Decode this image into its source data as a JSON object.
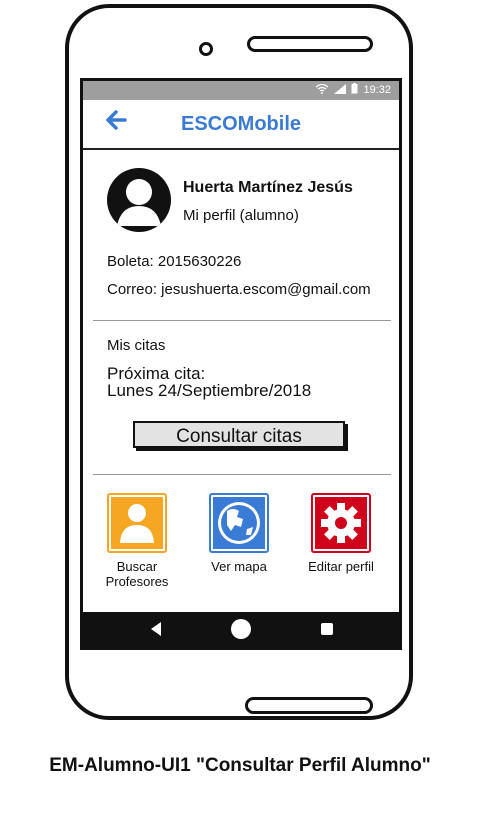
{
  "status": {
    "time": "19:32"
  },
  "appbar": {
    "title": "ESCOMobile",
    "back_icon": "arrow-left-icon"
  },
  "profile": {
    "name": "Huerta Martínez Jesús",
    "role": "Mi perfil (alumno)",
    "boleta": "Boleta:  2015630226",
    "correo": "Correo: jesushuerta.escom@gmail.com"
  },
  "citas": {
    "heading": "Mis citas",
    "proxima_label": "Próxima cita:",
    "proxima_value": "Lunes 24/Septiembre/2018",
    "button": "Consultar citas"
  },
  "actions": [
    {
      "label_line1": "Buscar",
      "label_line2": "Profesores",
      "icon": "person-icon",
      "color": "#f5a623"
    },
    {
      "label_line1": "Ver mapa",
      "label_line2": "",
      "icon": "globe-icon",
      "color": "#3a7bd5"
    },
    {
      "label_line1": "Editar perfil",
      "label_line2": "",
      "icon": "gear-icon",
      "color": "#d0021b"
    }
  ],
  "caption": "EM-Alumno-UI1 \"Consultar Perfil Alumno\""
}
